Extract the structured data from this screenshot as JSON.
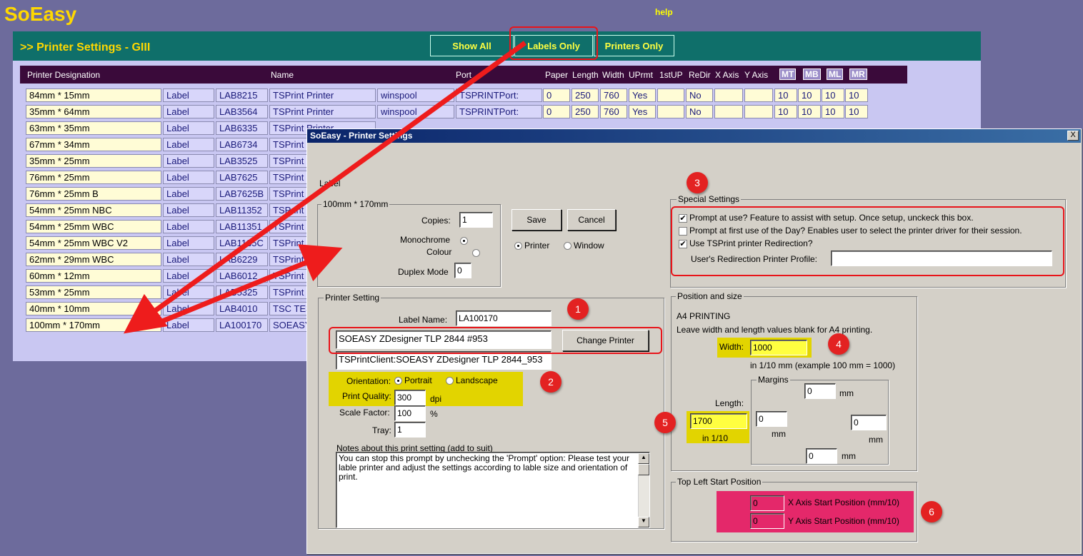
{
  "app": {
    "logo": "SoEasy",
    "help": "help"
  },
  "page": {
    "title": ">> Printer Settings - GIII"
  },
  "filters": {
    "show_all": "Show All",
    "labels_only": "Labels Only",
    "printers_only": "Printers Only"
  },
  "table": {
    "headers": {
      "designation": "Printer Designation",
      "name": "Name",
      "port": "Port",
      "paper": "Paper",
      "length": "Length",
      "width": "Width",
      "uprmt": "UPrmt",
      "firstup": "1stUP",
      "redir": "ReDir",
      "xaxis": "X Axis",
      "yaxis": "Y Axis",
      "mt": "MT",
      "mb": "MB",
      "ml": "ML",
      "mr": "MR"
    },
    "rows": [
      {
        "designation": "84mm * 15mm",
        "type": "Label",
        "code": "LAB8215",
        "name": "TSPrint Printer",
        "driver": "winspool",
        "port": "TSPRINTPort:",
        "paper": "0",
        "length": "250",
        "width": "760",
        "uprmt": "Yes",
        "firstup": "",
        "redir": "No",
        "x": "",
        "y": "",
        "mt": "10",
        "mb": "10",
        "ml": "10",
        "mr": "10"
      },
      {
        "designation": "35mm * 64mm",
        "type": "Label",
        "code": "LAB3564",
        "name": "TSPrint Printer",
        "driver": "winspool",
        "port": "TSPRINTPort:",
        "paper": "0",
        "length": "250",
        "width": "760",
        "uprmt": "Yes",
        "firstup": "",
        "redir": "No",
        "x": "",
        "y": "",
        "mt": "10",
        "mb": "10",
        "ml": "10",
        "mr": "10"
      },
      {
        "designation": "63mm * 35mm",
        "type": "Label",
        "code": "LAB6335",
        "name": "TSPrint Printer"
      },
      {
        "designation": "67mm * 34mm",
        "type": "Label",
        "code": "LAB6734",
        "name": "TSPrint"
      },
      {
        "designation": "35mm * 25mm",
        "type": "Label",
        "code": "LAB3525",
        "name": "TSPrint"
      },
      {
        "designation": "76mm * 25mm",
        "type": "Label",
        "code": "LAB7625",
        "name": "TSPrint"
      },
      {
        "designation": "76mm * 25mm B",
        "type": "Label",
        "code": "LAB7625B",
        "name": "TSPrint"
      },
      {
        "designation": "54mm * 25mm NBC",
        "type": "Label",
        "code": "LAB11352",
        "name": "TSPrint"
      },
      {
        "designation": "54mm * 25mm WBC",
        "type": "Label",
        "code": "LAB11351",
        "name": "TSPrint"
      },
      {
        "designation": "54mm * 25mm WBC V2",
        "type": "Label",
        "code": "LAB1135C",
        "name": "TSPrint"
      },
      {
        "designation": "62mm * 29mm WBC",
        "type": "Label",
        "code": "LAB6229",
        "name": "TSPrint"
      },
      {
        "designation": "60mm * 12mm",
        "type": "Label",
        "code": "LAB6012",
        "name": "TSPrint"
      },
      {
        "designation": "53mm * 25mm",
        "type": "Label",
        "code": "LAB5325",
        "name": "TSPrint"
      },
      {
        "designation": "40mm * 10mm",
        "type": "Label",
        "code": "LAB4010",
        "name": "TSC TE3"
      },
      {
        "designation": "100mm * 170mm",
        "type": "Label",
        "code": "LA100170",
        "name": "SOEASY"
      }
    ]
  },
  "dialog": {
    "title": "SoEasy - Printer Settings",
    "close": "X",
    "label_type": "Label",
    "size_group": "100mm * 170mm",
    "copies_label": "Copies:",
    "copies": "1",
    "monochrome": "Monochrome",
    "colour": "Colour",
    "duplex_label": "Duplex Mode",
    "duplex": "0",
    "save": "Save",
    "cancel": "Cancel",
    "printer_opt": "Printer",
    "window_opt": "Window",
    "special": {
      "title": "Special Settings",
      "opt1": "Prompt at use? Feature to assist with setup. Once setup, unckeck this box.",
      "opt2": "Prompt at first use of the Day? Enables user to select the printer driver for their session.",
      "opt3": "Use TSPrint printer Redirection?",
      "profile_label": "User's Redirection Printer Profile:",
      "profile": ""
    },
    "printer_setting": {
      "title": "Printer Setting",
      "label_name_label": "Label Name:",
      "label_name": "LA100170",
      "printer": "SOEASY ZDesigner TLP 2844 #953",
      "change_printer": "Change Printer",
      "client": "TSPrintClient:SOEASY ZDesigner TLP 2844_953",
      "orientation_label": "Orientation:",
      "portrait": "Portrait",
      "landscape": "Landscape",
      "quality_label": "Print Quality:",
      "quality": "300",
      "dpi": "dpi",
      "scale_label": "Scale Factor:",
      "scale": "100",
      "pct": "%",
      "tray_label": "Tray:",
      "tray": "1",
      "notes_label": "Notes about this print setting (add to suit)",
      "notes": "You can stop this prompt by unchecking the 'Prompt' option: Please test your lable printer and adjust the settings according to lable size and orientation of print."
    },
    "position": {
      "title": "Position and size",
      "a4": "A4 PRINTING",
      "hint": "Leave width and length values blank for A4 printing.",
      "width_label": "Width:",
      "width": "1000",
      "width_hint": "in 1/10 mm (example 100 mm = 1000)",
      "length_label": "Length:",
      "length": "1700",
      "length_hint": "in 1/10",
      "margins": "Margins",
      "mm": "mm",
      "mt": "0",
      "ml": "0",
      "mr": "0",
      "mb": "0"
    },
    "topleft": {
      "title": "Top Left Start Position",
      "x": "0",
      "x_label": "X Axis Start Position (mm/10)",
      "y": "0",
      "y_label": "Y Axis Start Position (mm/10)"
    }
  },
  "callouts": [
    "1",
    "2",
    "3",
    "4",
    "5",
    "6"
  ]
}
